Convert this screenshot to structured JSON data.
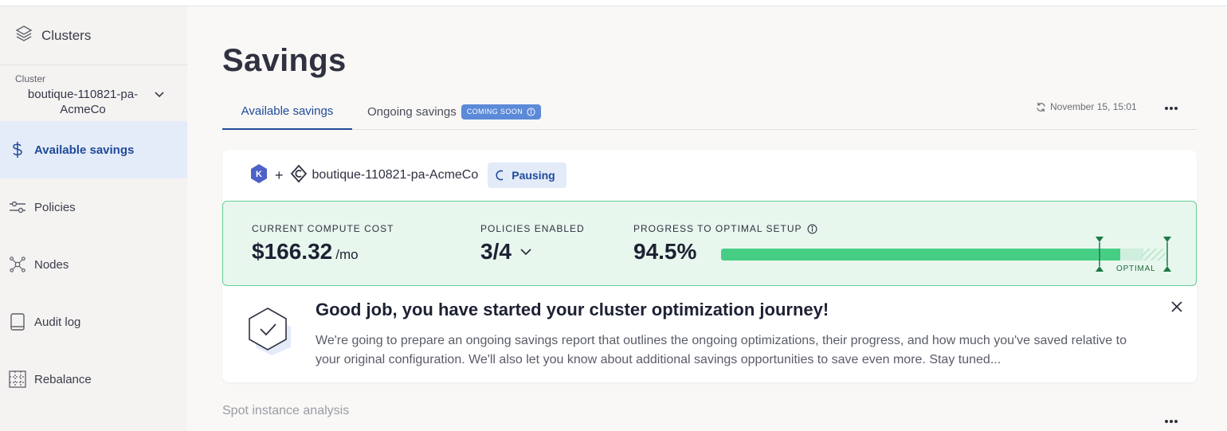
{
  "sidebar": {
    "title": "Clusters",
    "title_icon": "layers-icon",
    "cluster_caption": "Cluster",
    "cluster_name": "boutique-110821-pa-AcmeCo",
    "items": [
      {
        "label": "Available savings",
        "icon": "dollar-icon",
        "active": true
      },
      {
        "label": "Policies",
        "icon": "sliders-icon",
        "active": false
      },
      {
        "label": "Nodes",
        "icon": "nodes-icon",
        "active": false
      },
      {
        "label": "Audit log",
        "icon": "book-icon",
        "active": false
      },
      {
        "label": "Rebalance",
        "icon": "rebalance-icon",
        "active": false
      }
    ]
  },
  "main": {
    "title": "Savings",
    "tabs": [
      {
        "label": "Available savings",
        "active": true
      },
      {
        "label": "Ongoing savings",
        "active": false,
        "badge": "COMING SOON"
      }
    ],
    "refresh_time": "November 15, 15:01"
  },
  "card": {
    "cluster_name": "boutique-110821-pa-AcmeCo",
    "plus": "+",
    "status": "Pausing",
    "metrics": {
      "cost_label": "CURRENT COMPUTE COST",
      "cost_value": "$166.32",
      "cost_unit": "/mo",
      "policies_label": "POLICIES ENABLED",
      "policies_value": "3/4",
      "progress_label": "PROGRESS TO OPTIMAL SETUP",
      "progress_value": "94.5%",
      "progress_fraction": 0.945,
      "optimal_label": "OPTIMAL"
    },
    "notice": {
      "title": "Good job, you have started your cluster optimization journey!",
      "body": "We're going to prepare an ongoing savings report that outlines the ongoing optimizations, their progress, and how much you've saved relative to your original configuration. We'll also let you know about additional savings opportunities to save even more. Stay tuned..."
    }
  },
  "spot_section": {
    "title": "Spot instance analysis"
  },
  "colors": {
    "accent": "#1f4a9a",
    "success": "#46ce84",
    "success_border": "#66cf93",
    "success_bg": "#e8f7ee"
  }
}
